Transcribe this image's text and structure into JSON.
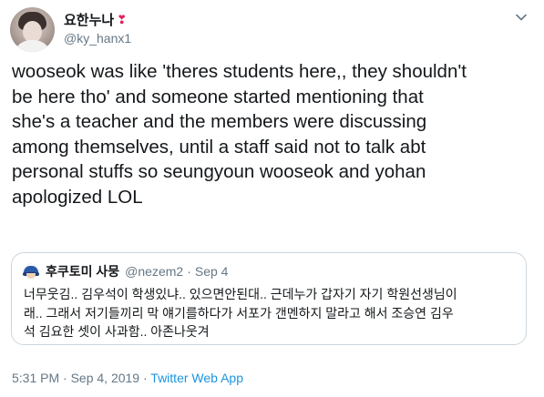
{
  "author": {
    "display_name": "요한누나",
    "handle": "@ky_hanx1",
    "name_emoji": "❣"
  },
  "tweet": {
    "text": "wooseok was like 'theres students here,, they shouldn't\nbe here tho' and someone started mentioning that\nshe's a teacher and the members were discussing\namong themselves, until a staff said not to talk abt\npersonal stuffs so seungyoun wooseok and yohan\napologized LOL"
  },
  "quoted_tweet": {
    "display_name": "후쿠토미 사뭉",
    "handle": "@nezem2",
    "separator": "·",
    "date": "Sep 4",
    "text": "너무웃김.. 김우석이 학생있냐.. 있으면안된대.. 근데누가 갑자기 자기 학원선생님이\n래.. 그래서 저기들끼리 막 얘기를하다가 서포가 갠멘하지 말라고 해서 조승연 김우\n석 김요한 셋이 사과함.. 아존나웃겨"
  },
  "meta": {
    "timestamp": "5:31 PM · Sep 4, 2019",
    "separator": " · ",
    "source": "Twitter Web App"
  },
  "icons": {
    "menu": "chevron-down-icon",
    "name_badge": "heart-icon"
  },
  "colors": {
    "link": "#1b95e0",
    "secondary_text": "#657786",
    "border": "#ccd6dd",
    "heart": "#e0245e"
  }
}
